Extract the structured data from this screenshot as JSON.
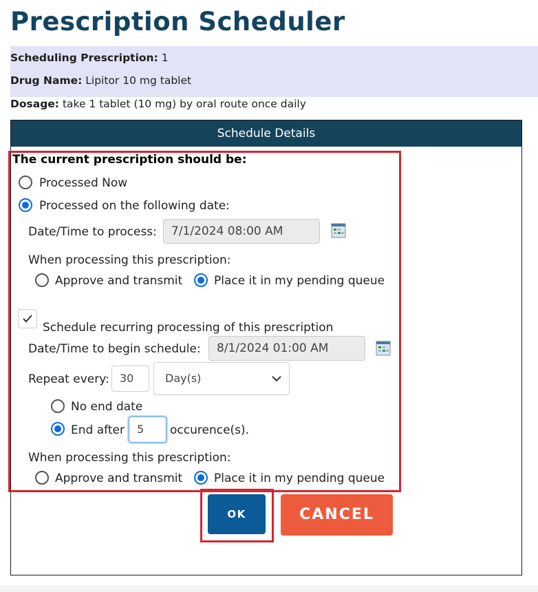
{
  "page": {
    "title": "Prescription Scheduler"
  },
  "prescription": {
    "scheduling_label": "Scheduling Prescription:",
    "scheduling_value": "1",
    "drug_label": "Drug Name:",
    "drug_value": "Lipitor 10 mg tablet",
    "dosage_label": "Dosage:",
    "dosage_value": "take 1 tablet (10 mg) by oral route once daily"
  },
  "panel": {
    "header": "Schedule Details",
    "section_title": "The current prescription should be:",
    "process_options": [
      {
        "label": "Processed Now",
        "selected": false
      },
      {
        "label": "Processed on the following date:",
        "selected": true
      }
    ],
    "process_datetime_label": "Date/Time to process:",
    "process_datetime_value": "7/1/2024 08:00 AM",
    "when_processing_label": "When processing this prescription:",
    "process_actions": [
      {
        "label": "Approve and transmit",
        "selected": false
      },
      {
        "label": "Place it in my pending queue",
        "selected": true
      }
    ],
    "recurring": {
      "checkbox_label": "Schedule recurring processing of this prescription",
      "checked": true,
      "begin_label": "Date/Time to begin schedule:",
      "begin_value": "8/1/2024 01:00 AM",
      "repeat_label": "Repeat every:",
      "repeat_value": "30",
      "repeat_unit": "Day(s)",
      "end_options": [
        {
          "label": "No end date",
          "selected": false
        },
        {
          "label": "End after",
          "selected": true
        }
      ],
      "end_after_value": "5",
      "end_after_suffix": "occurence(s).",
      "when_processing_label": "When processing this prescription:",
      "actions": [
        {
          "label": "Approve and transmit",
          "selected": false
        },
        {
          "label": "Place it in my pending queue",
          "selected": true
        }
      ]
    }
  },
  "buttons": {
    "ok": "OK",
    "cancel": "CANCEL"
  },
  "colors": {
    "title": "#13435f",
    "header_bg": "#15435c",
    "info_band": "#e1e4f7",
    "radio_selected": "#0a6de0",
    "ok_button": "#0b5b98",
    "cancel_button": "#ee5b3c",
    "highlight": "#d8242f"
  },
  "icons": {
    "calendar": "calendar-icon",
    "checkmark": "checkmark-icon",
    "chevron": "chevron-down-icon"
  }
}
